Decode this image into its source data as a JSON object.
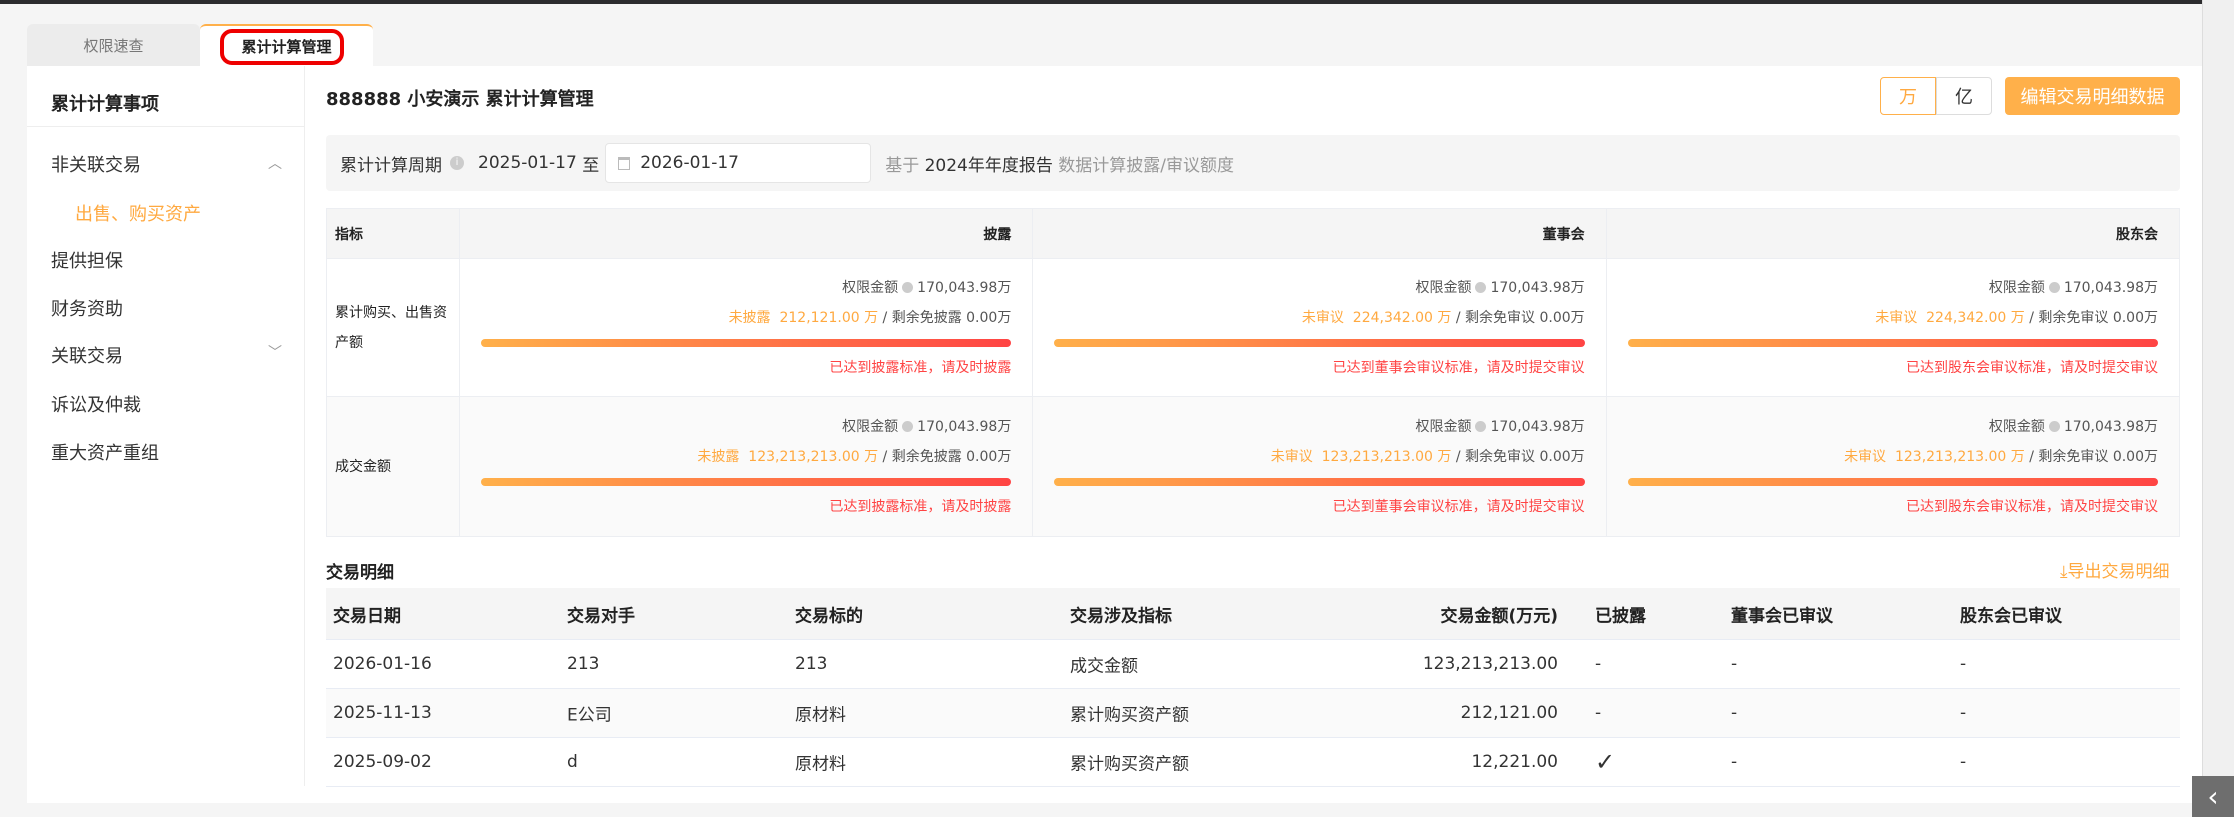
{
  "tabs": [
    {
      "label": "权限速查"
    },
    {
      "label": "累计计算管理"
    }
  ],
  "sidebar": {
    "title": "累计计算事项",
    "items": [
      {
        "label": "非关联交易",
        "chevron": "up"
      },
      {
        "label": "出售、购买资产",
        "sub": true
      },
      {
        "label": "提供担保"
      },
      {
        "label": "财务资助"
      },
      {
        "label": "关联交易",
        "chevron": "down"
      },
      {
        "label": "诉讼及仲裁"
      },
      {
        "label": "重大资产重组"
      }
    ]
  },
  "header": {
    "title": "888888 小安演示 累计计算管理",
    "unit_wan": "万",
    "unit_yi": "亿",
    "edit_button": "编辑交易明细数据"
  },
  "period": {
    "label": "累计计算周期",
    "start": "2025-01-17",
    "to": "至",
    "end": "2026-01-17",
    "basis_prefix": "基于",
    "basis_report": "2024年年度报告",
    "basis_suffix": "数据计算披露/审议额度"
  },
  "summary": {
    "headers": [
      "指标",
      "披露",
      "董事会",
      "股东会"
    ],
    "rows": [
      {
        "indicator": "累计购买、出售资产额",
        "cells": [
          {
            "limit_label": "权限金额",
            "limit": "170,043.98万",
            "status": "未披露",
            "amount": "212,121.00 万",
            "remain": "/ 剩余免披露 0.00万",
            "warn": "已达到披露标准，请及时披露",
            "progress": 1.0
          },
          {
            "limit_label": "权限金额",
            "limit": "170,043.98万",
            "status": "未审议",
            "amount": "224,342.00 万",
            "remain": "/ 剩余免审议 0.00万",
            "warn": "已达到董事会审议标准，请及时提交审议",
            "progress": 1.0
          },
          {
            "limit_label": "权限金额",
            "limit": "170,043.98万",
            "status": "未审议",
            "amount": "224,342.00 万",
            "remain": "/ 剩余免审议 0.00万",
            "warn": "已达到股东会审议标准，请及时提交审议",
            "progress": 1.0
          }
        ]
      },
      {
        "indicator": "成交金额",
        "cells": [
          {
            "limit_label": "权限金额",
            "limit": "170,043.98万",
            "status": "未披露",
            "amount": "123,213,213.00 万",
            "remain": "/ 剩余免披露 0.00万",
            "warn": "已达到披露标准，请及时披露",
            "progress": 1.0
          },
          {
            "limit_label": "权限金额",
            "limit": "170,043.98万",
            "status": "未审议",
            "amount": "123,213,213.00 万",
            "remain": "/ 剩余免审议 0.00万",
            "warn": "已达到董事会审议标准，请及时提交审议",
            "progress": 1.0
          },
          {
            "limit_label": "权限金额",
            "limit": "170,043.98万",
            "status": "未审议",
            "amount": "123,213,213.00 万",
            "remain": "/ 剩余免审议 0.00万",
            "warn": "已达到股东会审议标准，请及时提交审议",
            "progress": 1.0
          }
        ]
      }
    ]
  },
  "details": {
    "title": "交易明细",
    "export": "导出交易明细",
    "headers": [
      "交易日期",
      "交易对手",
      "交易标的",
      "交易涉及指标",
      "交易金额(万元)",
      "已披露",
      "董事会已审议",
      "股东会已审议"
    ],
    "rows": [
      [
        "2026-01-16",
        "213",
        "213",
        "成交金额",
        "123,213,213.00",
        "-",
        "-",
        "-"
      ],
      [
        "2025-11-13",
        "E公司",
        "原材料",
        "累计购买资产额",
        "212,121.00",
        "-",
        "-",
        "-"
      ],
      [
        "2025-09-02",
        "d",
        "原材料",
        "累计购买资产额",
        "12,221.00",
        "✓",
        "-",
        "-"
      ]
    ]
  },
  "colors": {
    "accent": "#ffb04a",
    "danger": "#ff4444"
  }
}
